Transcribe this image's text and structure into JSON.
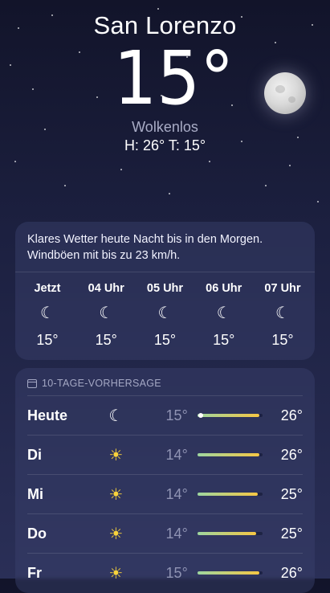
{
  "location": {
    "city": "San Lorenzo",
    "temperature": "15°",
    "condition": "Wolkenlos",
    "hi_lo": "H: 26°  T: 15°"
  },
  "hourly": {
    "summary": "Klares Wetter heute Nacht bis in den Morgen. Windböen mit bis zu 23 km/h.",
    "hours": [
      {
        "label": "Jetzt",
        "icon": "moon-stars-icon",
        "temp": "15°"
      },
      {
        "label": "04 Uhr",
        "icon": "moon-stars-icon",
        "temp": "15°"
      },
      {
        "label": "05 Uhr",
        "icon": "moon-stars-icon",
        "temp": "15°"
      },
      {
        "label": "06 Uhr",
        "icon": "moon-stars-icon",
        "temp": "15°"
      },
      {
        "label": "07 Uhr",
        "icon": "moon-stars-icon",
        "temp": "15°"
      }
    ]
  },
  "daily": {
    "header": "10-TAGE-VORHERSAGE",
    "days": [
      {
        "day": "Heute",
        "icon": "moon-stars-icon",
        "low": "15°",
        "high": "26°",
        "range_start": 0.0,
        "range_end": 0.95,
        "current_marker": 0.02
      },
      {
        "day": "Di",
        "icon": "sun-icon",
        "low": "14°",
        "high": "26°",
        "range_start": 0.0,
        "range_end": 0.95
      },
      {
        "day": "Mi",
        "icon": "sun-icon",
        "low": "14°",
        "high": "25°",
        "range_start": 0.0,
        "range_end": 0.92
      },
      {
        "day": "Do",
        "icon": "sun-icon",
        "low": "14°",
        "high": "25°",
        "range_start": 0.0,
        "range_end": 0.9
      },
      {
        "day": "Fr",
        "icon": "sun-icon",
        "low": "15°",
        "high": "26°",
        "range_start": 0.0,
        "range_end": 0.95
      }
    ]
  },
  "colors": {
    "bar_gradient_start": "#9ed6a0",
    "bar_gradient_end": "#f6c744",
    "card": "#3c426e"
  }
}
